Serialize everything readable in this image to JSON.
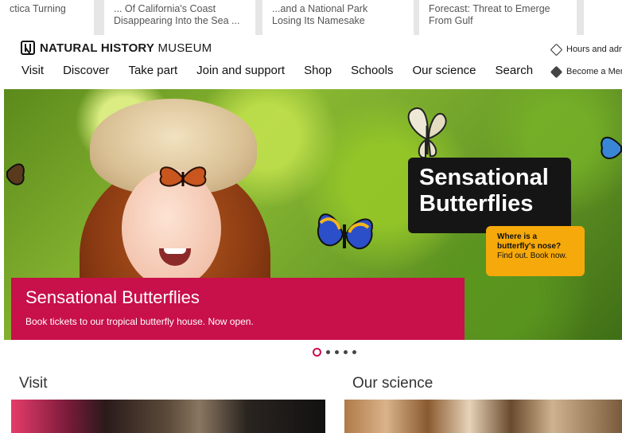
{
  "strip": {
    "articles": [
      {
        "line1": "ctica Turning",
        "line2": ""
      },
      {
        "line1": "... Of California's Coast",
        "line2": "Disappearing Into the Sea ..."
      },
      {
        "line1": "...and a National Park",
        "line2": "Losing Its Namesake"
      },
      {
        "line1": "Forecast: Threat to Emerge",
        "line2": "From Gulf"
      }
    ]
  },
  "header": {
    "logo_bold": "NATURAL HISTORY",
    "logo_light": "MUSEUM",
    "utility": {
      "hours": "Hours and adm",
      "member": "Become a Mem"
    },
    "nav": [
      "Visit",
      "Discover",
      "Take part",
      "Join and support",
      "Shop",
      "Schools",
      "Our science",
      "Search"
    ]
  },
  "hero": {
    "promo_title_line1": "Sensational",
    "promo_title_line2": "Butterflies",
    "sticker_line1": "Where is a",
    "sticker_line2": "butterfly's nose?",
    "sticker_line3": "Find out. Book now.",
    "caption_title": "Sensational Butterflies",
    "caption_sub": "Book tickets to our tropical butterfly house. Now open."
  },
  "carousel": {
    "slides": 5,
    "active": 1
  },
  "sections": {
    "visit": "Visit",
    "science": "Our science"
  },
  "colors": {
    "accent": "#c8104a",
    "sticker": "#f6a90b",
    "promo_box": "#151515"
  }
}
